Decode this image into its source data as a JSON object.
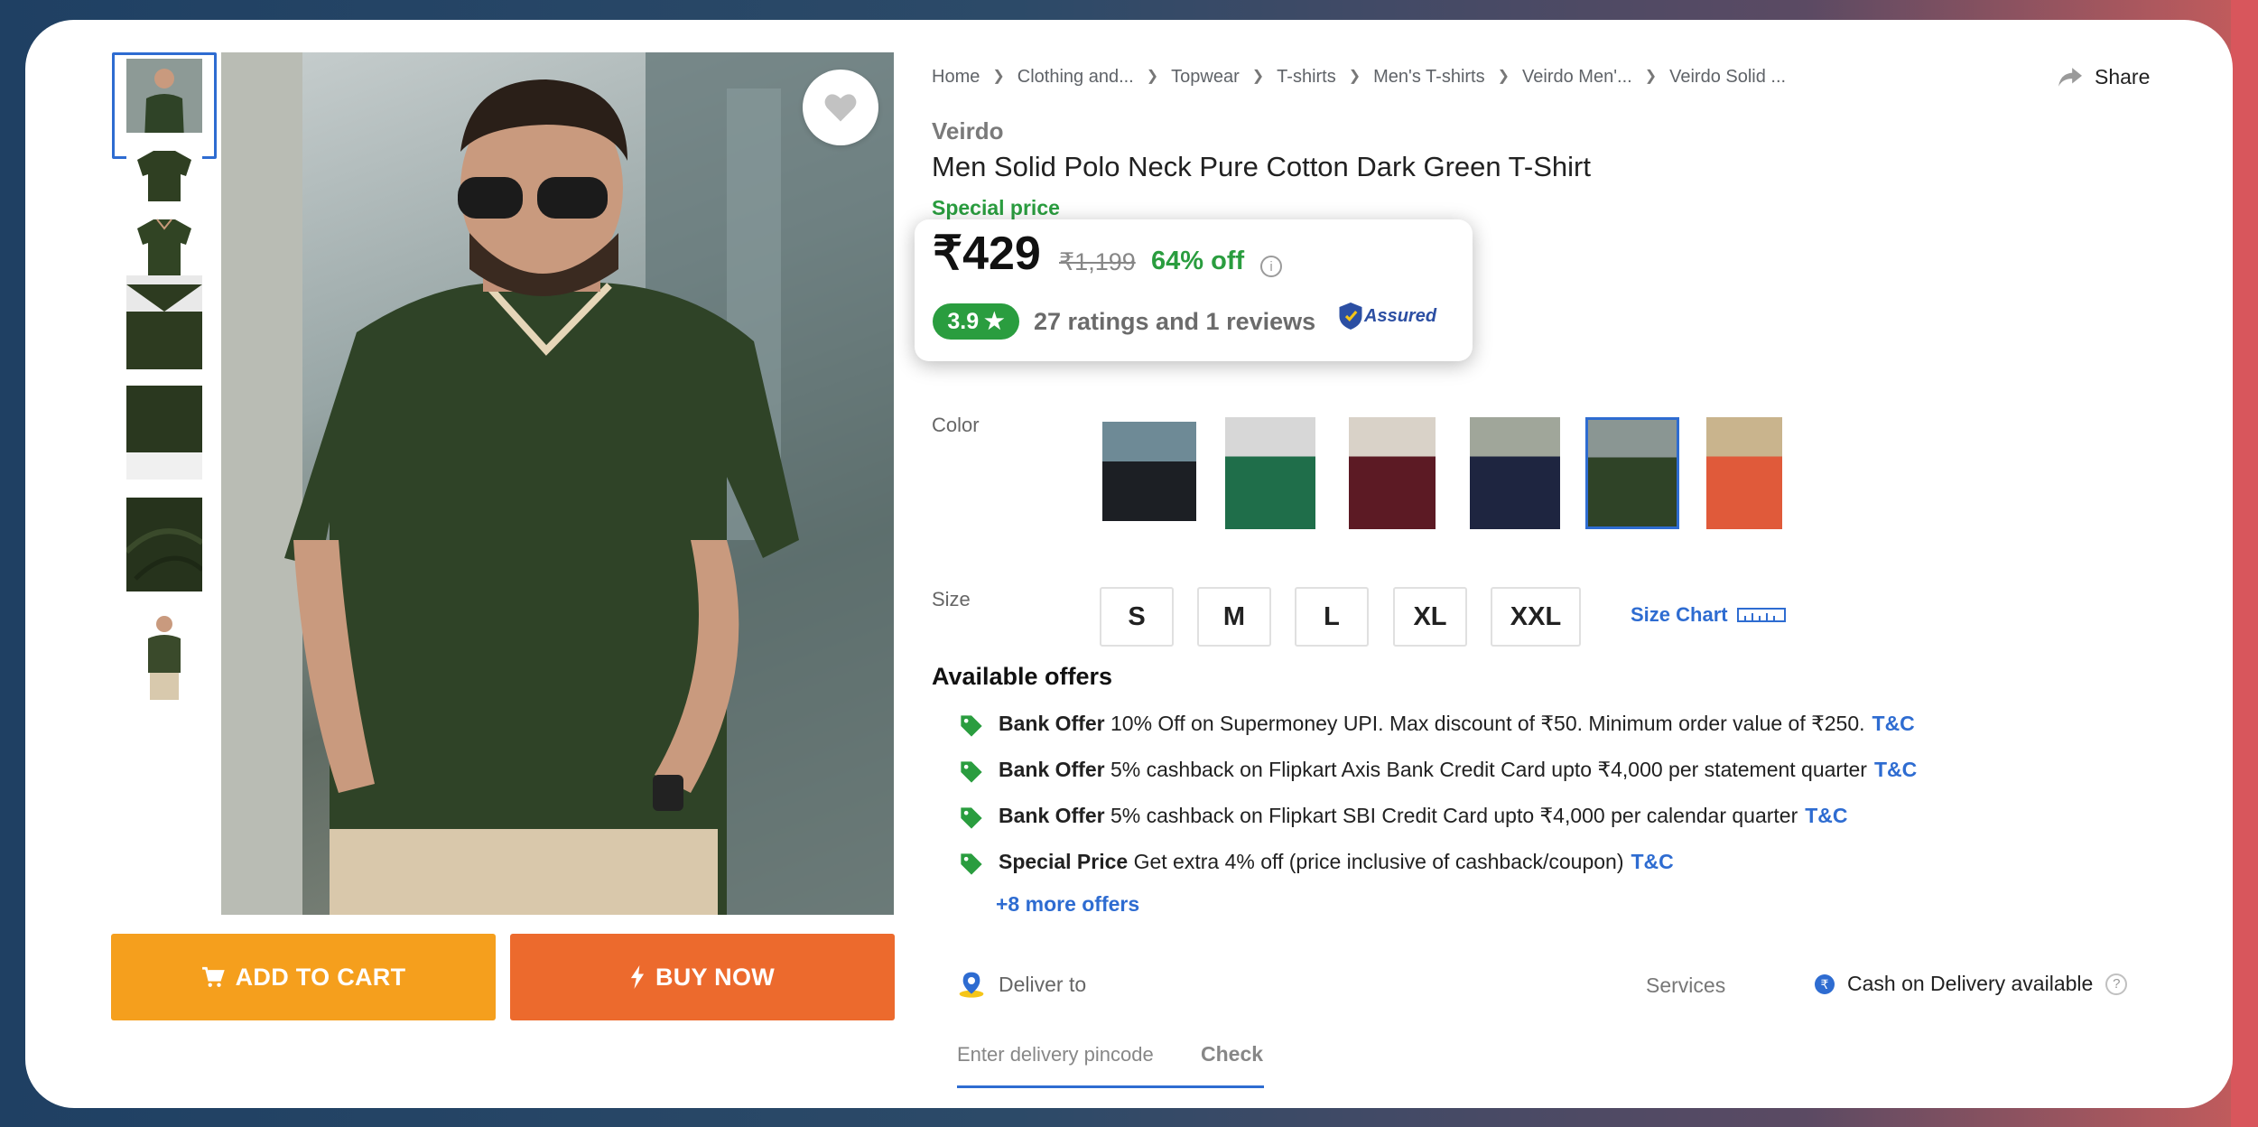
{
  "share_label": "Share",
  "breadcrumb": [
    "Home",
    "Clothing and...",
    "Topwear",
    "T-shirts",
    "Men's T-shirts",
    "Veirdo Men'...",
    "Veirdo Solid ..."
  ],
  "product": {
    "brand": "Veirdo",
    "title": "Men Solid Polo Neck Pure Cotton Dark Green T-Shirt",
    "special_price_label": "Special price",
    "price": "₹429",
    "mrp": "₹1,199",
    "discount": "64% off",
    "rating": "3.9",
    "ratings_text": "27 ratings and 1 reviews",
    "assured_label": "Assured"
  },
  "thumbnails": [
    {
      "color": "#3a4b2a"
    },
    {
      "color": "#2f3f22"
    },
    {
      "color": "#314424"
    },
    {
      "color": "#2d3b20"
    },
    {
      "color": "#2a381f"
    },
    {
      "color": "#26331c"
    },
    {
      "color": "#3a4a2b"
    }
  ],
  "color_label": "Color",
  "colors": [
    {
      "name": "black",
      "hex": "#1c1f24"
    },
    {
      "name": "green",
      "hex": "#1f6e4a"
    },
    {
      "name": "maroon",
      "hex": "#5c1a24"
    },
    {
      "name": "navy",
      "hex": "#1e2540"
    },
    {
      "name": "dark-green",
      "hex": "#2f4327"
    },
    {
      "name": "orange",
      "hex": "#e05a3a"
    }
  ],
  "size_label": "Size",
  "sizes": [
    "S",
    "M",
    "L",
    "XL",
    "XXL"
  ],
  "size_chart_label": "Size Chart",
  "offers_title": "Available offers",
  "offers": [
    {
      "type": "Bank Offer",
      "text": "10% Off on Supermoney UPI. Max discount of ₹50. Minimum order value of ₹250.",
      "tc": "T&C"
    },
    {
      "type": "Bank Offer",
      "text": "5% cashback on Flipkart Axis Bank Credit Card upto ₹4,000 per statement quarter",
      "tc": "T&C"
    },
    {
      "type": "Bank Offer",
      "text": "5% cashback on Flipkart SBI Credit Card upto ₹4,000 per calendar quarter",
      "tc": "T&C"
    },
    {
      "type": "Special Price",
      "text": "Get extra 4% off (price inclusive of cashback/coupon)",
      "tc": "T&C"
    }
  ],
  "more_offers": "+8 more offers",
  "buttons": {
    "add_to_cart": "ADD TO CART",
    "buy_now": "BUY NOW"
  },
  "delivery": {
    "deliver_to": "Deliver to",
    "pincode_placeholder": "Enter delivery pincode",
    "check": "Check",
    "services_label": "Services",
    "cod": "Cash on Delivery available"
  },
  "accent_colors": {
    "blue": "#2e6cd1",
    "green": "#2a9d3f",
    "cart": "#f59f1d",
    "buy": "#ec6a2d"
  }
}
